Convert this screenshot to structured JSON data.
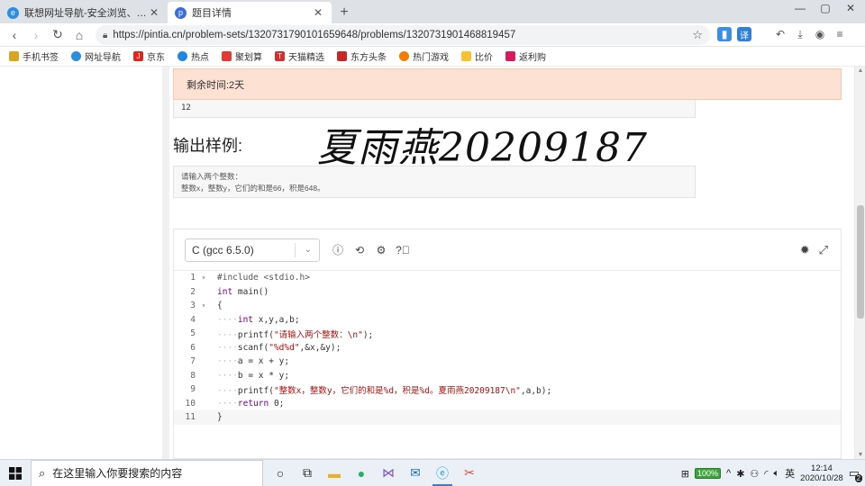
{
  "tabs": [
    {
      "title": "联想网址导航-安全浏览、极速体验",
      "icon": "browser-e-icon",
      "color": "#2a8fe0",
      "active": false
    },
    {
      "title": "题目详情",
      "icon": "pintia-icon",
      "color": "#3a6fd8",
      "active": true
    }
  ],
  "addressbar": {
    "url": "https://pintia.cn/problem-sets/1320731790101659648/problems/1320731901468819457"
  },
  "bookmarks": [
    {
      "label": "手机书签",
      "color": "#d9a520"
    },
    {
      "label": "网址导航",
      "color": "#2a8fe0"
    },
    {
      "label": "京东",
      "color": "#e1251b"
    },
    {
      "label": "热点",
      "color": "#1e88e5"
    },
    {
      "label": "聚划算",
      "color": "#e53935"
    },
    {
      "label": "天猫精选",
      "color": "#d32f2f"
    },
    {
      "label": "东方头条",
      "color": "#c62828"
    },
    {
      "label": "热门游戏",
      "color": "#f57c00"
    },
    {
      "label": "比价",
      "color": "#fbc02d"
    },
    {
      "label": "返利购",
      "color": "#d81b60"
    }
  ],
  "problem": {
    "remaining_time": "剩余时间:2天",
    "input_sample_tail": "12",
    "output_sample_heading": "输出样例:",
    "signature": "夏雨燕20209187",
    "output_sample_lines": [
      "请输入两个整数：",
      "整数x，整数y，它们的和是66，积是648。"
    ]
  },
  "editor": {
    "language": "C (gcc 6.5.0)",
    "code_lines": [
      {
        "n": "1",
        "fold": "▾",
        "html": "<span class='pre'>#include &lt;stdio.h&gt;</span>"
      },
      {
        "n": "2",
        "fold": "",
        "html": "<span class='kw'>int</span> main()"
      },
      {
        "n": "3",
        "fold": "▾",
        "html": "{"
      },
      {
        "n": "4",
        "fold": "",
        "html": "<span class='dots'>····</span><span class='kw'>int</span> x,y,a,b;"
      },
      {
        "n": "5",
        "fold": "",
        "html": "<span class='dots'>····</span>printf(<span class='str'>\"请输入两个整数：\\n\"</span>);"
      },
      {
        "n": "6",
        "fold": "",
        "html": "<span class='dots'>····</span>scanf(<span class='str'>\"%d%d\"</span>,&amp;x,&amp;y);"
      },
      {
        "n": "7",
        "fold": "",
        "html": "<span class='dots'>····</span>a = x + y;"
      },
      {
        "n": "8",
        "fold": "",
        "html": "<span class='dots'>····</span>b = x * y;"
      },
      {
        "n": "9",
        "fold": "",
        "html": "<span class='dots'>····</span>printf(<span class='str'>\"整数x，整数y，它们的和是%d，积是%d。夏雨燕20209187\\n\"</span>,a,b);"
      },
      {
        "n": "10",
        "fold": "",
        "html": "<span class='dots'>····</span><span class='kw'>return</span> 0;"
      },
      {
        "n": "11",
        "fold": "",
        "html": "}"
      }
    ]
  },
  "taskbar": {
    "search_placeholder": "在这里输入你要搜索的内容",
    "battery": "100%",
    "ime": "英",
    "time": "12:14",
    "date": "2020/10/28",
    "notification_count": "2"
  }
}
